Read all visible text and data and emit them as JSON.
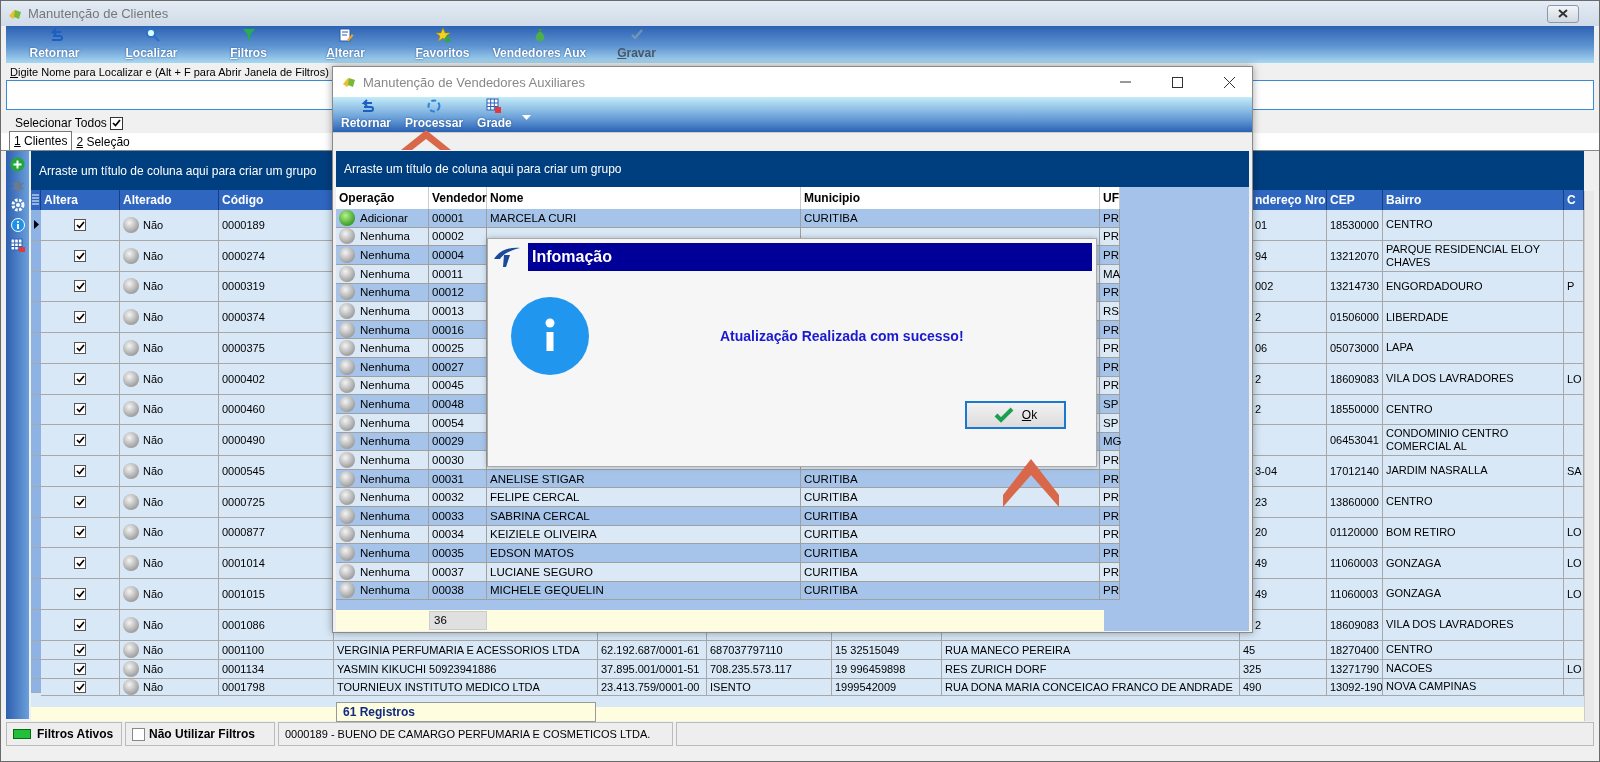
{
  "window": {
    "title": "Manutenção de Clientes"
  },
  "toolbar": [
    {
      "label": "Retornar",
      "accelerator": false,
      "disabled": false
    },
    {
      "label": "Localizar",
      "accelerator": true,
      "disabled": false
    },
    {
      "label": "Filtros",
      "accelerator": true,
      "disabled": false
    },
    {
      "label": "Alterar",
      "accelerator": true,
      "disabled": false
    },
    {
      "label": "Favoritos",
      "accelerator": true,
      "disabled": false
    },
    {
      "label": "Vendedores Aux",
      "accelerator": false,
      "disabled": false
    },
    {
      "label": "Gravar",
      "accelerator": true,
      "disabled": true
    }
  ],
  "search": {
    "label": "Digite Nome para Localizar e (Alt + F para Abrir Janela de Filtros)"
  },
  "select_all": {
    "label": "Selecionar Todos",
    "checked": true
  },
  "tabs": [
    {
      "label": "1 Clientes",
      "selected": true
    },
    {
      "label": "2 Seleção",
      "selected": false
    }
  ],
  "group_panel": "Arraste um título de coluna aqui para criar um grupo",
  "table": {
    "columns": [
      "Altera",
      "Alterado",
      "Código",
      "ndereço Nro",
      "CEP",
      "Bairro",
      "C"
    ],
    "rows": [
      {
        "selected": true,
        "altera": true,
        "alterado": "Não",
        "codigo": "0000189",
        "nro": "01",
        "cep": "18530000",
        "bairro": "CENTRO"
      },
      {
        "selected": false,
        "altera": true,
        "alterado": "Não",
        "codigo": "0000274",
        "nro": "94",
        "cep": "13212070",
        "bairro": "PARQUE RESIDENCIAL ELOY CHAVES"
      },
      {
        "selected": false,
        "altera": true,
        "alterado": "Não",
        "codigo": "0000319",
        "nro": "002",
        "cep": "13214730",
        "bairro": "ENGORDADOURO",
        "column_13": "P"
      },
      {
        "selected": false,
        "altera": true,
        "alterado": "Não",
        "codigo": "0000374",
        "nro": "2",
        "cep": "01506000",
        "bairro": "LIBERDADE"
      },
      {
        "selected": false,
        "altera": true,
        "alterado": "Não",
        "codigo": "0000375",
        "nro": "06",
        "cep": "05073000",
        "bairro": "LAPA"
      },
      {
        "selected": false,
        "altera": true,
        "alterado": "Não",
        "codigo": "0000402",
        "nro": "2",
        "cep": "18609083",
        "bairro": "VILA DOS LAVRADORES",
        "column_13": "LO"
      },
      {
        "selected": false,
        "altera": true,
        "alterado": "Não",
        "codigo": "0000460",
        "nro": "2",
        "cep": "18550000",
        "bairro": "CENTRO"
      },
      {
        "selected": false,
        "altera": true,
        "alterado": "Não",
        "codigo": "0000490",
        "cep": "06453041",
        "bairro": "CONDOMINIO CENTRO COMERCIAL AL"
      },
      {
        "selected": false,
        "altera": true,
        "alterado": "Não",
        "codigo": "0000545",
        "nro": "3-04",
        "cep": "17012140",
        "bairro": "JARDIM NASRALLA",
        "column_13": "SA"
      },
      {
        "selected": false,
        "altera": true,
        "alterado": "Não",
        "codigo": "0000725",
        "nro": "23",
        "cep": "13860000",
        "bairro": "CENTRO"
      },
      {
        "selected": false,
        "altera": true,
        "alterado": "Não",
        "codigo": "0000877",
        "nro": "20",
        "cep": "01120000",
        "bairro": "BOM RETIRO",
        "column_13": "LO"
      },
      {
        "selected": false,
        "altera": true,
        "alterado": "Não",
        "codigo": "0001014",
        "nro": "49",
        "cep": "11060003",
        "bairro": "GONZAGA",
        "column_13": "LO"
      },
      {
        "selected": false,
        "altera": true,
        "alterado": "Não",
        "codigo": "0001015",
        "nro": "49",
        "cep": "11060003",
        "bairro": "GONZAGA",
        "column_13": "LO"
      },
      {
        "selected": false,
        "altera": true,
        "alterado": "Não",
        "codigo": "0001086",
        "nro": "2",
        "cep": "18609083",
        "bairro": "VILA DOS LAVRADORES"
      },
      {
        "selected": false,
        "altera": true,
        "alterado": "Não",
        "codigo": "0001100",
        "nome": "VERGINIA PERFUMARIA E ACESSORIOS LTDA",
        "cnpj": "62.192.687/0001-61",
        "ie": "687037797110",
        "fone": "15 32515049",
        "endereco": "RUA MANECO PEREIRA",
        "nro": "45",
        "cep": "18270400",
        "bairro": "CENTRO"
      },
      {
        "selected": false,
        "altera": true,
        "alterado": "Não",
        "codigo": "0001134",
        "nome": "YASMIN KIKUCHI 50923941886",
        "cnpj": "37.895.001/0001-51",
        "ie": "708.235.573.117",
        "fone": "19 996459898",
        "endereco": "RES ZURICH DORF",
        "nro": "325",
        "cep": "13271790",
        "bairro": "NACOES",
        "column_13": "LO"
      },
      {
        "selected": false,
        "altera": true,
        "alterado": "Não",
        "codigo": "0001798",
        "nome": "TOURNIEUX INSTITUTO MEDICO LTDA",
        "cnpj": "23.413.759/0001-00",
        "ie": "ISENTO",
        "fone": "1999542009",
        "endereco": "RUA DONA MARIA CONCEICAO FRANCO DE ANDRADE",
        "nro": "490",
        "cep": "13092-190",
        "bairro": "NOVA CAMPINAS"
      }
    ],
    "footer_count": "61 Registros"
  },
  "status_bar": {
    "filters_label": "Filtros Ativos",
    "no_filters": {
      "label": "Não Utilizar Filtros",
      "checked": false
    },
    "record": "0000189 - BUENO DE CAMARGO PERFUMARIA E COSMETICOS LTDA."
  },
  "vendor_window": {
    "title": "Manutenção de Vendedores Auxiliares",
    "toolbar": [
      {
        "label": "Retornar"
      },
      {
        "label": "Processar"
      },
      {
        "label": "Grade"
      }
    ],
    "group_panel": "Arraste um título de coluna aqui para criar um grupo",
    "columns": [
      "Operação",
      "Vendedor",
      "Nome",
      "Municipio",
      "UF"
    ],
    "rows": [
      {
        "kind": "add",
        "operacao": "Adicionar",
        "vendedor": "00001",
        "nome": "MARCELA CURI",
        "municipio": "CURITIBA",
        "uf": "PR"
      },
      {
        "kind": "none",
        "operacao": "Nenhuma",
        "vendedor": "00002",
        "uf": "PR"
      },
      {
        "kind": "none",
        "operacao": "Nenhuma",
        "vendedor": "00004",
        "uf": "PR"
      },
      {
        "kind": "none",
        "operacao": "Nenhuma",
        "vendedor": "00011",
        "uf": "MA"
      },
      {
        "kind": "none",
        "operacao": "Nenhuma",
        "vendedor": "00012",
        "uf": "PR"
      },
      {
        "kind": "none",
        "operacao": "Nenhuma",
        "vendedor": "00013",
        "uf": "RS"
      },
      {
        "kind": "none",
        "operacao": "Nenhuma",
        "vendedor": "00016",
        "uf": "PR"
      },
      {
        "kind": "none",
        "operacao": "Nenhuma",
        "vendedor": "00025",
        "uf": "PR"
      },
      {
        "kind": "none",
        "operacao": "Nenhuma",
        "vendedor": "00027",
        "uf": "PR"
      },
      {
        "kind": "none",
        "operacao": "Nenhuma",
        "vendedor": "00045",
        "uf": "PR"
      },
      {
        "kind": "none",
        "operacao": "Nenhuma",
        "vendedor": "00048",
        "uf": "SP"
      },
      {
        "kind": "none",
        "operacao": "Nenhuma",
        "vendedor": "00054",
        "uf": "SP"
      },
      {
        "kind": "none",
        "operacao": "Nenhuma",
        "vendedor": "00029",
        "uf": "MG"
      },
      {
        "kind": "none",
        "operacao": "Nenhuma",
        "vendedor": "00030",
        "uf": "PR"
      },
      {
        "kind": "none",
        "operacao": "Nenhuma",
        "vendedor": "00031",
        "nome": "ANELISE STIGAR",
        "municipio": "CURITIBA",
        "uf": "PR"
      },
      {
        "kind": "none",
        "operacao": "Nenhuma",
        "vendedor": "00032",
        "nome": "FELIPE CERCAL",
        "municipio": "CURITIBA",
        "uf": "PR"
      },
      {
        "kind": "none",
        "operacao": "Nenhuma",
        "vendedor": "00033",
        "nome": "SABRINA CERCAL",
        "municipio": "CURITIBA",
        "uf": "PR"
      },
      {
        "kind": "none",
        "operacao": "Nenhuma",
        "vendedor": "00034",
        "nome": "KEIZIELE OLIVEIRA",
        "municipio": "CURITIBA",
        "uf": "PR"
      },
      {
        "kind": "none",
        "operacao": "Nenhuma",
        "vendedor": "00035",
        "nome": "EDSON MATOS",
        "municipio": "CURITIBA",
        "uf": "PR"
      },
      {
        "kind": "none",
        "operacao": "Nenhuma",
        "vendedor": "00037",
        "nome": "LUCIANE SEGURO",
        "municipio": "CURITIBA",
        "uf": "PR"
      },
      {
        "kind": "none",
        "operacao": "Nenhuma",
        "vendedor": "00038",
        "nome": "MICHELE GEQUELIN",
        "municipio": "CURITIBA",
        "uf": "PR"
      }
    ],
    "footer_count": "36"
  },
  "dialog": {
    "title": "Infomação",
    "message": "Atualização Realizada com sucesso!",
    "ok_button": "Ok"
  }
}
